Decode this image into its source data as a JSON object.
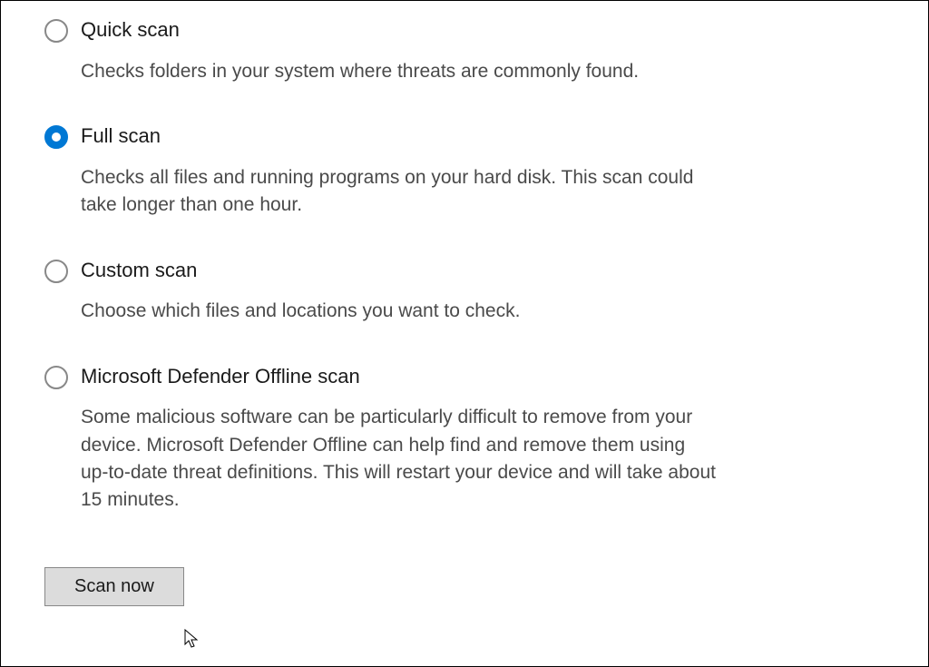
{
  "scan_options": [
    {
      "id": "quick",
      "label": "Quick scan",
      "description": "Checks folders in your system where threats are commonly found.",
      "selected": false
    },
    {
      "id": "full",
      "label": "Full scan",
      "description": "Checks all files and running programs on your hard disk. This scan could take longer than one hour.",
      "selected": true
    },
    {
      "id": "custom",
      "label": "Custom scan",
      "description": "Choose which files and locations you want to check.",
      "selected": false
    },
    {
      "id": "offline",
      "label": "Microsoft Defender Offline scan",
      "description": "Some malicious software can be particularly difficult to remove from your device. Microsoft Defender Offline can help find and remove them using up-to-date threat definitions. This will restart your device and will take about 15 minutes.",
      "selected": false
    }
  ],
  "button": {
    "scan_now_label": "Scan now"
  },
  "colors": {
    "accent": "#0078d4"
  }
}
